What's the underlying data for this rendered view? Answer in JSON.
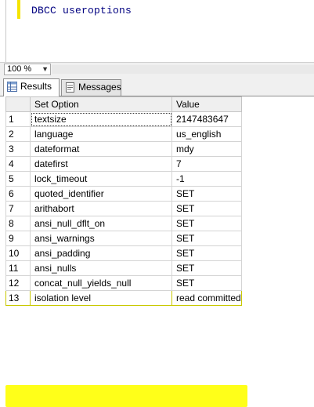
{
  "editor": {
    "code": "DBCC useroptions"
  },
  "zoom": {
    "value": "100 %"
  },
  "tabs": {
    "results": "Results",
    "messages": "Messages"
  },
  "grid": {
    "columns": [
      "Set Option",
      "Value"
    ],
    "rows": [
      {
        "n": "1",
        "option": "textsize",
        "value": "2147483647"
      },
      {
        "n": "2",
        "option": "language",
        "value": "us_english"
      },
      {
        "n": "3",
        "option": "dateformat",
        "value": "mdy"
      },
      {
        "n": "4",
        "option": "datefirst",
        "value": "7"
      },
      {
        "n": "5",
        "option": "lock_timeout",
        "value": "-1"
      },
      {
        "n": "6",
        "option": "quoted_identifier",
        "value": "SET"
      },
      {
        "n": "7",
        "option": "arithabort",
        "value": "SET"
      },
      {
        "n": "8",
        "option": "ansi_null_dflt_on",
        "value": "SET"
      },
      {
        "n": "9",
        "option": "ansi_warnings",
        "value": "SET"
      },
      {
        "n": "10",
        "option": "ansi_padding",
        "value": "SET"
      },
      {
        "n": "11",
        "option": "ansi_nulls",
        "value": "SET"
      },
      {
        "n": "12",
        "option": "concat_null_yields_null",
        "value": "SET"
      },
      {
        "n": "13",
        "option": "isolation level",
        "value": "read committed"
      }
    ]
  },
  "colors": {
    "highlight": "#ffff00",
    "code_text": "#000080"
  }
}
